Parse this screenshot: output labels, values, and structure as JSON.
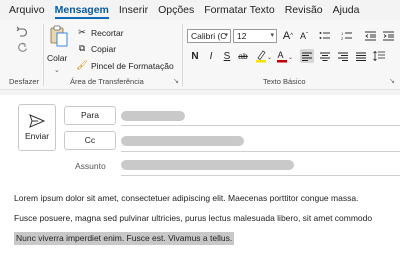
{
  "menu": {
    "items": [
      {
        "label": "Arquivo",
        "active": false
      },
      {
        "label": "Mensagem",
        "active": true
      },
      {
        "label": "Inserir",
        "active": false
      },
      {
        "label": "Opções",
        "active": false
      },
      {
        "label": "Formatar Texto",
        "active": false
      },
      {
        "label": "Revisão",
        "active": false
      },
      {
        "label": "Ajuda",
        "active": false
      }
    ]
  },
  "ribbon": {
    "undo_group": {
      "label": "Desfazer",
      "undo_icon": "undo-icon",
      "redo_icon": "redo-icon"
    },
    "clipboard_group": {
      "label": "Área de Transferência",
      "paste_label": "Colar",
      "cut_label": "Recortar",
      "copy_label": "Copiar",
      "format_painter_label": "Pincel de Formatação",
      "launcher": "↘"
    },
    "basic_text_group": {
      "label": "Texto Básico",
      "font_name": "Calibri (C",
      "font_size": "12",
      "grow_font": "A",
      "shrink_font": "A",
      "bold": "N",
      "italic": "I",
      "underline": "S",
      "strikethrough": "ab",
      "launcher": "↘"
    }
  },
  "compose": {
    "send_label": "Enviar",
    "to_label": "Para",
    "cc_label": "Cc",
    "subject_label": "Assunto",
    "body": {
      "line1": "Lorem ipsum dolor sit amet, consectetuer adipiscing elit. Maecenas porttitor congue massa.",
      "line2": "Fusce posuere, magna sed pulvinar ultricies, purus lectus malesuada libero, sit amet commodo",
      "line3_selected": "Nunc viverra imperdiet enim. Fusce est. Vivamus a tellus."
    }
  },
  "colors": {
    "accent": "#0f6cbd",
    "highlight": "#f5e200",
    "font_color": "#c00000",
    "selection": "#c8c8c8"
  }
}
